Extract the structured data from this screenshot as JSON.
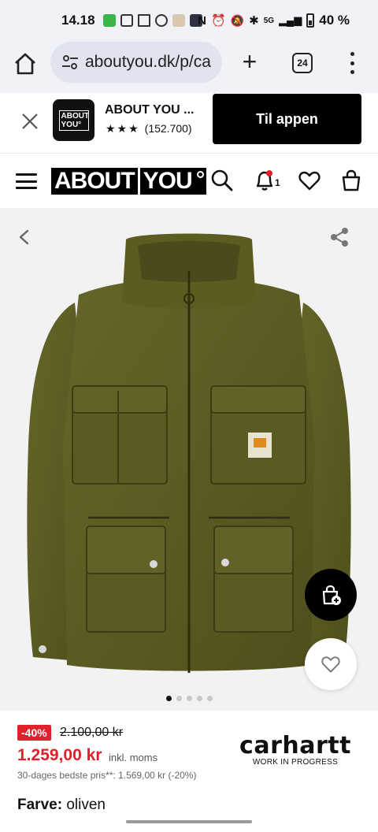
{
  "status_bar": {
    "time": "14.18",
    "network": "5G",
    "battery": "40 %"
  },
  "browser": {
    "url": "aboutyou.dk/p/ca",
    "tab_count": "24"
  },
  "app_banner": {
    "name": "ABOUT YOU ...",
    "rating_stars": "★★★",
    "rating_count": "(152.700)",
    "cta": "Til appen",
    "logo_text": "ABOUT YOU°"
  },
  "header": {
    "logo_part1": "ABOUT",
    "logo_part2": "YOU",
    "notification_count": "1"
  },
  "product": {
    "image_count": 5,
    "active_image": 0,
    "jacket_color": "#5a5a22"
  },
  "pricing": {
    "discount": "-40%",
    "old_price": "2.100,00 kr",
    "new_price": "1.259,00 kr",
    "vat_note": "inkl. moms",
    "best_price_note": "30-dages bedste pris**: 1.569,00 kr (-20%)"
  },
  "brand": {
    "name": "carhartt",
    "tagline": "WORK IN PROGRESS"
  },
  "color": {
    "label": "Farve:",
    "value": "oliven"
  },
  "colors": {
    "accent_red": "#e0202b",
    "black": "#000000",
    "bg_gray": "#f2f2f2"
  }
}
